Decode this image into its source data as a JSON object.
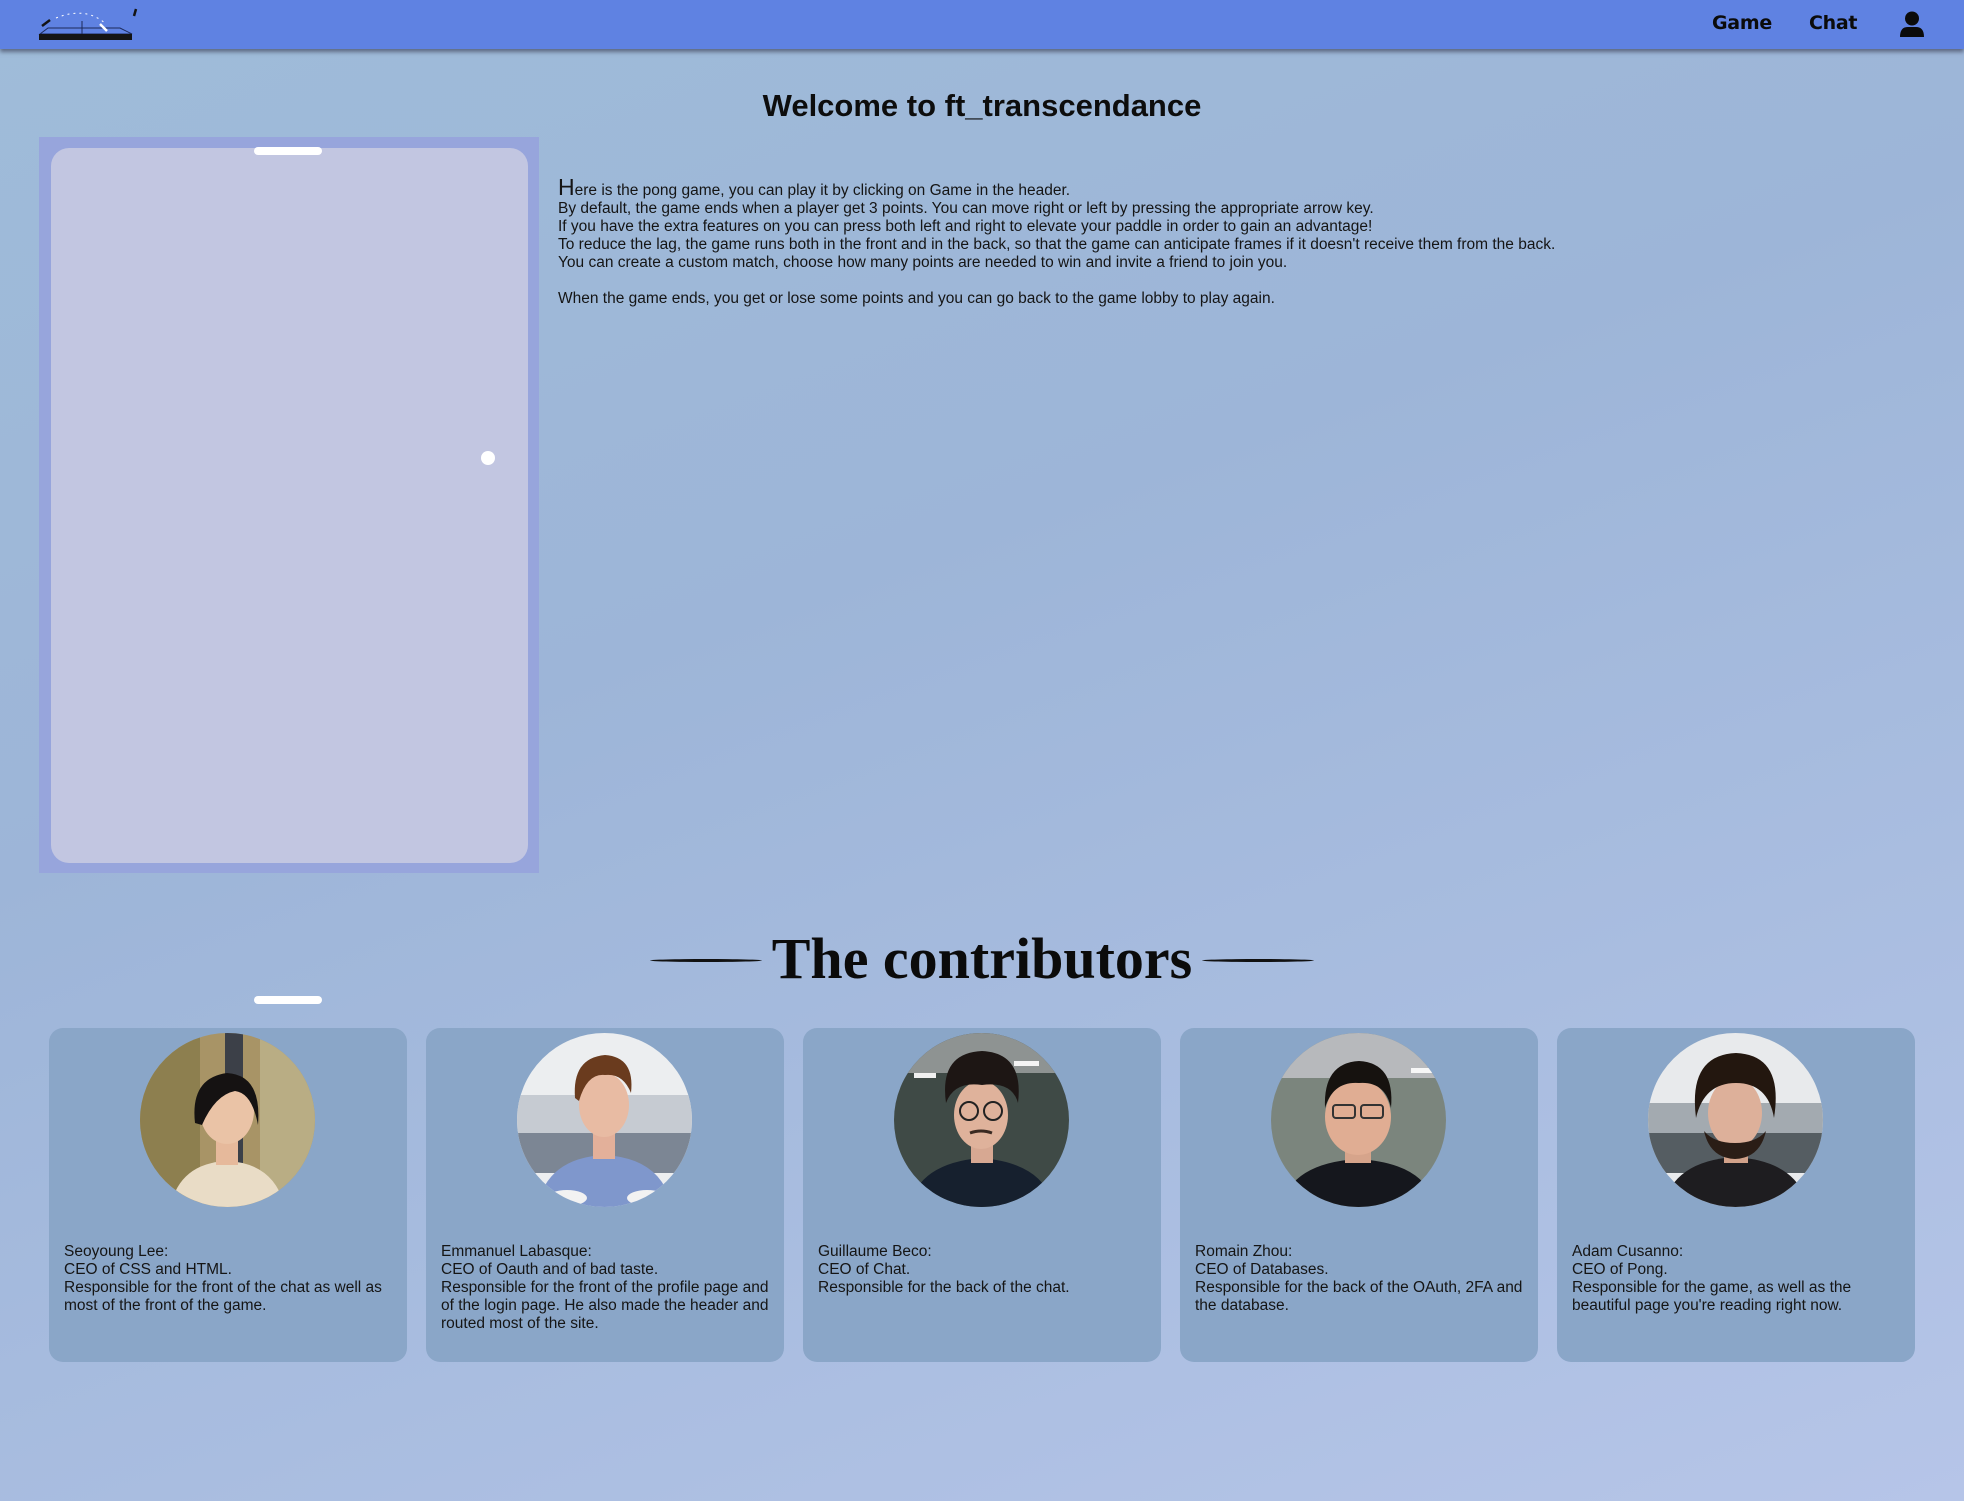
{
  "header": {
    "logo": "ping-pong-table-logo",
    "nav": [
      {
        "label": "Game"
      },
      {
        "label": "Chat"
      }
    ],
    "profile_icon": "user-icon",
    "background_color": "#5f82e2"
  },
  "main": {
    "title": "Welcome to ft_transcendance",
    "pong_preview": {
      "frame_color": "#97a5dc",
      "field_color": "#c2c6e1",
      "paddle_color": "#ffffff",
      "ball_color": "#ffffff"
    },
    "description": {
      "first_letter": "H",
      "lines": [
        "ere is the pong game, you can play it by clicking on Game in the header.",
        "By default, the game ends when a player get 3 points. You can move right or left by pressing the appropriate arrow key.",
        "If you have the extra features on you can press both left and right to elevate your paddle in order to gain an advantage!",
        "To reduce the lag, the game runs both in the front and in the back, so that the game can anticipate frames if it doesn't receive them from the back.",
        "You can create a custom match, choose how many points are needed to win and invite a friend to join you."
      ],
      "closing": "When the game ends, you get or lose some points and you can go back to the game lobby to play again."
    }
  },
  "contributors": {
    "title": "The contributors",
    "card_color": "#8aa6c8",
    "people": [
      {
        "name": "Seoyoung Lee:",
        "role": "CEO of CSS and HTML.",
        "responsibility": "Responsible for the front of the chat as well as most of the front of the game.",
        "avatar": "photo-seoyoung-lee"
      },
      {
        "name": "Emmanuel Labasque:",
        "role": "CEO of Oauth and of bad taste.",
        "responsibility": "Responsible for the front of the profile page and of the login page. He also made the header and routed most of the site.",
        "avatar": "photo-emmanuel-labasque"
      },
      {
        "name": "Guillaume Beco:",
        "role": "CEO of Chat.",
        "responsibility": "Responsible for the back of the chat.",
        "avatar": "photo-guillaume-beco"
      },
      {
        "name": "Romain Zhou:",
        "role": "CEO of Databases.",
        "responsibility": "Responsible for the back of the OAuth, 2FA and the database.",
        "avatar": "photo-romain-zhou"
      },
      {
        "name": "Adam Cusanno:",
        "role": "CEO of Pong.",
        "responsibility": "Responsible for the game, as well as the beautiful page you're reading right now.",
        "avatar": "photo-adam-cusanno"
      }
    ]
  }
}
